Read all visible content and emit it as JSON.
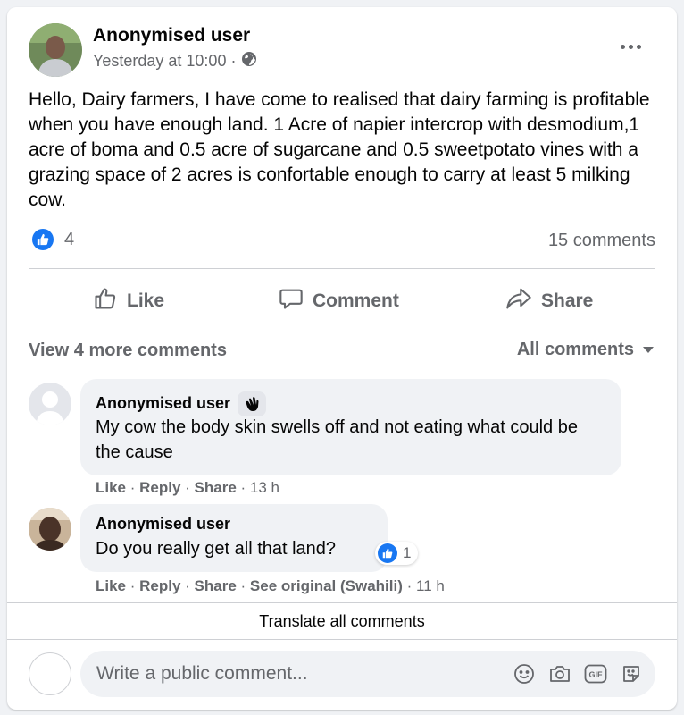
{
  "post": {
    "author": "Anonymised user",
    "timestamp": "Yesterday at 10:00 ·",
    "audience_icon": "globe-icon",
    "text": "Hello, Dairy farmers, I have come to realised that dairy farming is profitable when you have enough land. 1 Acre of napier intercrop with desmodium,1 acre of boma and 0.5 acre of sugarcane and 0.5 sweetpotato vines with a grazing space of 2 acres is confortable enough to carry at least 5 milking cow.",
    "reaction_count": "4",
    "comment_count": "15 comments"
  },
  "actions": {
    "like": "Like",
    "comment": "Comment",
    "share": "Share"
  },
  "comments_header": {
    "view_more": "View 4 more comments",
    "filter": "All comments"
  },
  "comments": [
    {
      "author": "Anonymised user",
      "text": "My cow the body skin swells off and not eating what could be the cause",
      "like": "Like",
      "reply": "Reply",
      "share": "Share",
      "time": "13 h"
    },
    {
      "author": "Anonymised user",
      "text": "Do you really get all that land?",
      "reaction_count": "1",
      "like": "Like",
      "reply": "Reply",
      "share": "Share",
      "see_original": "See original (Swahili)",
      "time": "11 h"
    }
  ],
  "translate_all": "Translate all comments",
  "composer": {
    "placeholder": "Write a public comment..."
  },
  "colors": {
    "brand_blue": "#1877f2",
    "secondary_text": "#65676b",
    "bubble_bg": "#f0f2f5"
  }
}
